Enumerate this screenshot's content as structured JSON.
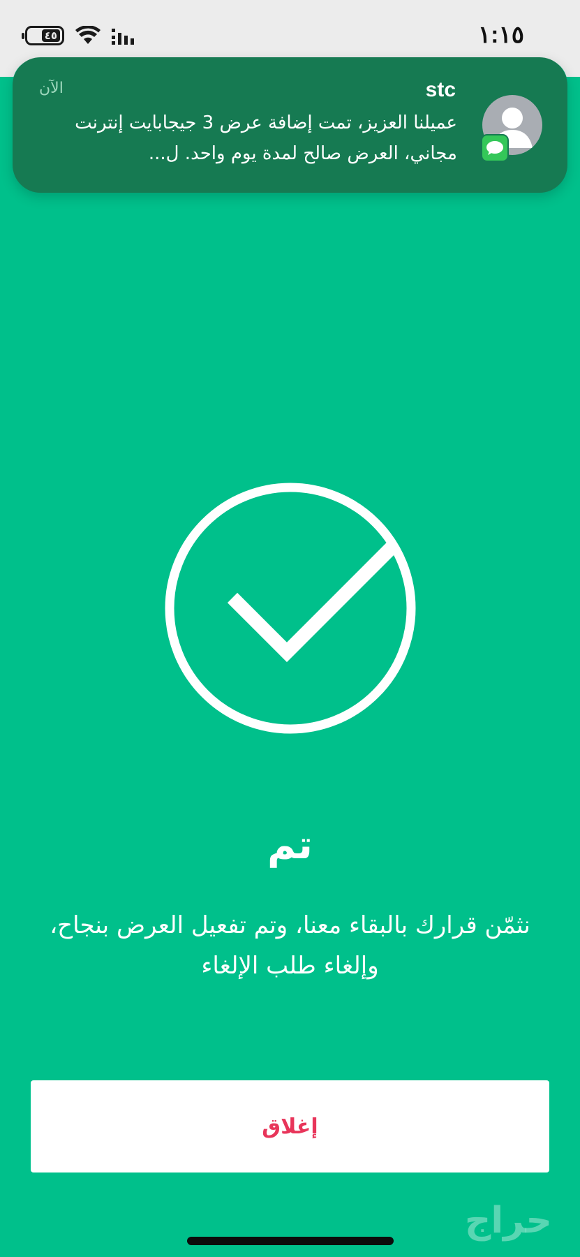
{
  "status_bar": {
    "time": "١:١٥",
    "battery_level": "٤٥",
    "icons": [
      "battery-icon",
      "wifi-icon",
      "cellular-signal-icon"
    ]
  },
  "notification": {
    "sender": "stc",
    "time": "الآن",
    "body": "عميلنا العزيز، تمت إضافة عرض 3 جيجابايت إنترنت مجاني، العرض صالح لمدة يوم واحد. ل...",
    "icons": [
      "contact-avatar-icon",
      "messages-app-icon"
    ]
  },
  "main": {
    "title": "تم",
    "message": "نثمّن قرارك بالبقاء معنا، وتم تفعيل العرض بنجاح، وإلغاء طلب الإلغاء",
    "close_label": "إغلاق",
    "icon": "success-check-icon"
  },
  "watermark": "حراج",
  "colors": {
    "background": "#00c08b",
    "notification": "#167a52",
    "close_text": "#e8355a",
    "status_bar": "#ececec"
  }
}
